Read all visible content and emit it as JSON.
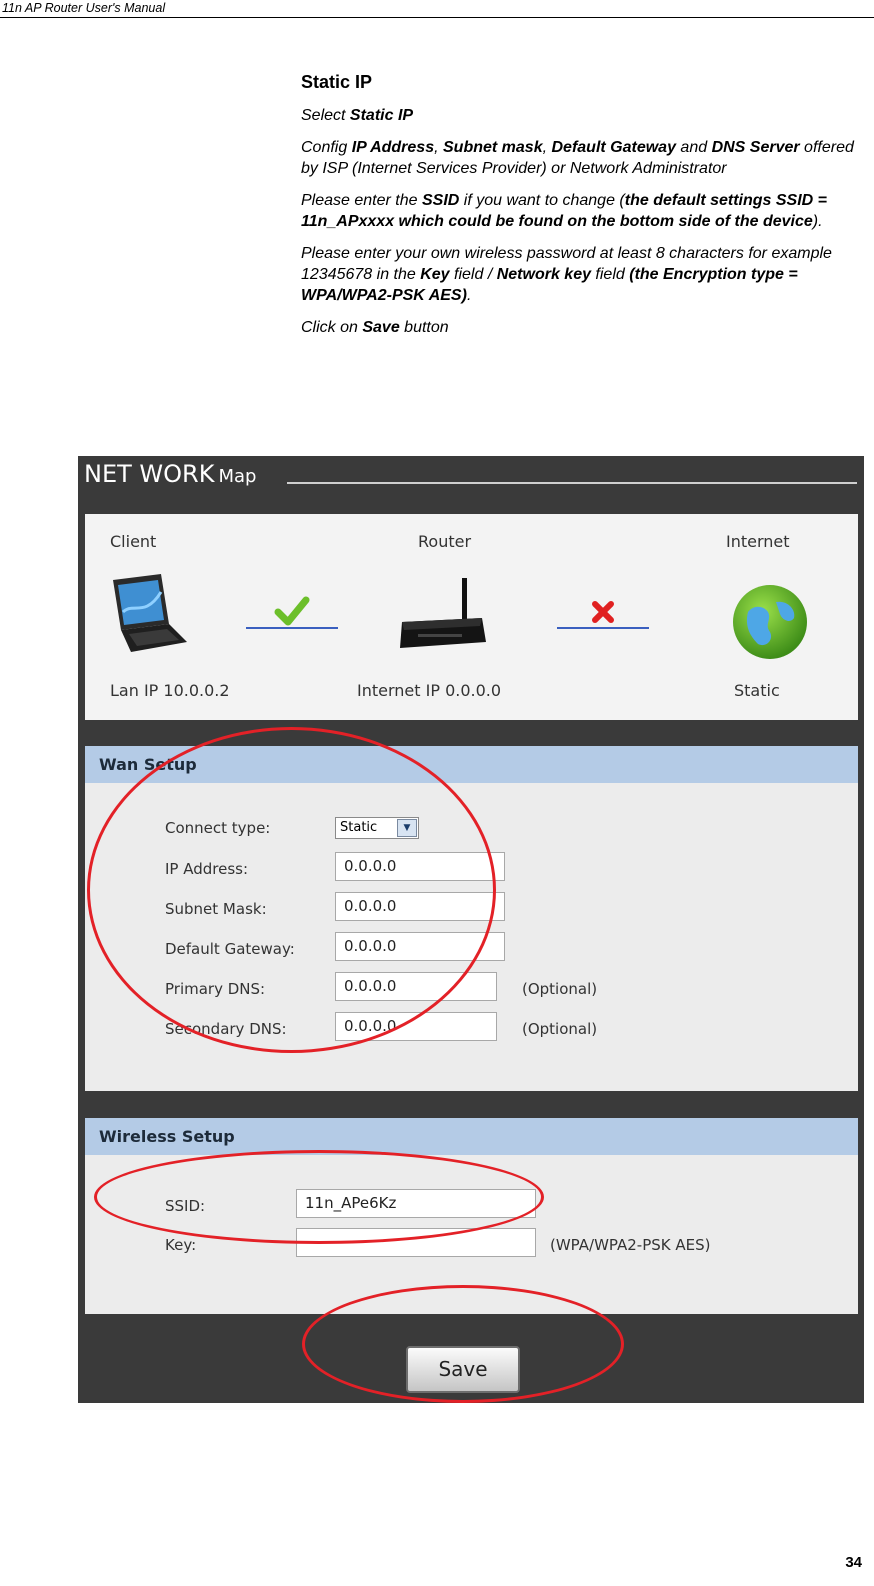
{
  "header": {
    "title": "11n AP Router User's Manual"
  },
  "doc": {
    "heading": "Static IP",
    "p1": [
      {
        "t": "Select ",
        "b": false
      },
      {
        "t": "Static IP",
        "b": true
      }
    ],
    "p2": [
      {
        "t": "Config ",
        "b": false
      },
      {
        "t": "IP Address",
        "b": true
      },
      {
        "t": ", ",
        "b": false
      },
      {
        "t": "Subnet mask",
        "b": true
      },
      {
        "t": ", ",
        "b": false
      },
      {
        "t": "Default Gateway",
        "b": true
      },
      {
        "t": " and ",
        "b": false
      },
      {
        "t": "DNS Server",
        "b": true
      },
      {
        "t": " offered by ISP (Internet Services Provider) or Network Administrator",
        "b": false
      }
    ],
    "p3": [
      {
        "t": "Please enter the ",
        "b": false
      },
      {
        "t": "SSID",
        "b": true
      },
      {
        "t": " if you want to change (",
        "b": false
      },
      {
        "t": "the default settings SSID = 11n_APxxxx which could be found on the bottom side of the device",
        "b": true
      },
      {
        "t": ").",
        "b": false
      }
    ],
    "p4": [
      {
        "t": "Please enter your own wireless password at least 8 characters for example 12345678 in the ",
        "b": false
      },
      {
        "t": "Key",
        "b": true
      },
      {
        "t": " field / ",
        "b": false
      },
      {
        "t": "Network key",
        "b": true
      },
      {
        "t": " field ",
        "b": false
      },
      {
        "t": "(the Encryption type = WPA/WPA2-PSK AES)",
        "b": true
      },
      {
        "t": ".",
        "b": false
      }
    ],
    "p5": [
      {
        "t": "Click on ",
        "b": false
      },
      {
        "t": "Save",
        "b": true
      },
      {
        "t": " button",
        "b": false
      }
    ]
  },
  "network_map": {
    "title": "NET WORK",
    "title_suffix": "Map",
    "client_label": "Client",
    "router_label": "Router",
    "internet_label": "Internet",
    "client_status": "Lan IP 10.0.0.2",
    "router_status": "Internet IP 0.0.0.0",
    "internet_status": "Static",
    "client_router_link": "connected",
    "router_internet_link": "disconnected"
  },
  "wan_setup": {
    "title": "Wan Setup",
    "connect_type_label": "Connect type:",
    "connect_type_value": "Static",
    "ip_label": "IP Address:",
    "ip_value": "0.0.0.0",
    "mask_label": "Subnet Mask:",
    "mask_value": "0.0.0.0",
    "gateway_label": "Default Gateway:",
    "gateway_value": "0.0.0.0",
    "dns1_label": "Primary DNS:",
    "dns1_value": "0.0.0.0",
    "dns1_note": "(Optional)",
    "dns2_label": "Secondary DNS:",
    "dns2_value": "0.0.0.0",
    "dns2_note": "(Optional)"
  },
  "wireless_setup": {
    "title": "Wireless Setup",
    "ssid_label": "SSID:",
    "ssid_value": "11n_APe6Kz",
    "key_label": "Key:",
    "key_value": "",
    "key_note": "(WPA/WPA2-PSK AES)"
  },
  "save_label": "Save",
  "colors": {
    "highlight_circle": "#e32127",
    "panel_header": "#b4cbe6",
    "background_dark": "#3a3a3a"
  },
  "page_number": "34"
}
